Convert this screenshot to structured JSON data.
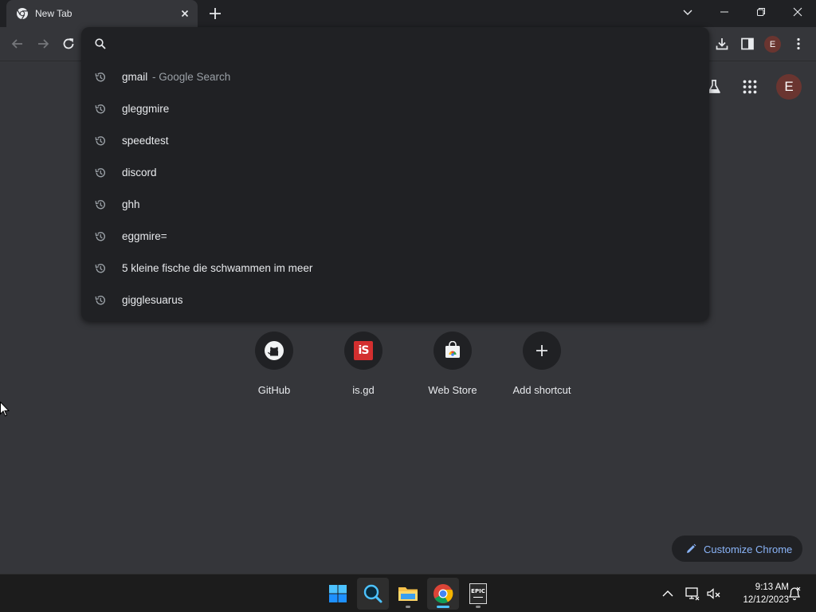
{
  "tab": {
    "title": "New Tab",
    "favicon": "chrome-icon"
  },
  "window_controls": [
    "tab-search-icon",
    "minimize-icon",
    "restore-icon",
    "close-icon"
  ],
  "toolbar": {
    "avatar_letter": "E",
    "icons": [
      "back-arrow-icon",
      "forward-arrow-icon",
      "reload-icon",
      "download-icon",
      "side-panel-icon",
      "menu-kebab-icon"
    ]
  },
  "omnibox": {
    "value": "",
    "placeholder": "",
    "suggestions": [
      {
        "text": "gmail",
        "description": "- Google Search",
        "icon": "history-icon"
      },
      {
        "text": "gleggmire",
        "description": "",
        "icon": "history-icon"
      },
      {
        "text": "speedtest",
        "description": "",
        "icon": "history-icon"
      },
      {
        "text": "discord",
        "description": "",
        "icon": "history-icon"
      },
      {
        "text": "ghh",
        "description": "",
        "icon": "history-icon"
      },
      {
        "text": "eggmire=",
        "description": "",
        "icon": "history-icon"
      },
      {
        "text": "5 kleine fische die schwammen im meer",
        "description": "",
        "icon": "history-icon"
      },
      {
        "text": "gigglesuarus",
        "description": "",
        "icon": "history-icon"
      }
    ]
  },
  "ntp": {
    "avatar_letter": "E",
    "header_icons": [
      "labs-flask-icon",
      "apps-grid-icon"
    ],
    "shortcuts": [
      {
        "label": "GitHub",
        "icon": "github-icon"
      },
      {
        "label": "is.gd",
        "icon": "isgd-icon"
      },
      {
        "label": "Web Store",
        "icon": "webstore-icon"
      },
      {
        "label": "Add shortcut",
        "icon": "plus-icon"
      }
    ],
    "customize_label": "Customize Chrome"
  },
  "taskbar": {
    "apps": [
      "windows-start-icon",
      "search-icon",
      "file-explorer-icon",
      "chrome-icon",
      "epic-games-icon"
    ],
    "epic_logo_text": "EPIC",
    "time": "9:13 AM",
    "date": "12/12/2023"
  },
  "colors": {
    "page_bg": "#35363a",
    "tabstrip_bg": "#202124",
    "popup_bg": "#202124",
    "accent_blue": "#8ab4f8",
    "avatar_bg": "#6a3530",
    "taskbar_bg": "#1c1c1c"
  }
}
